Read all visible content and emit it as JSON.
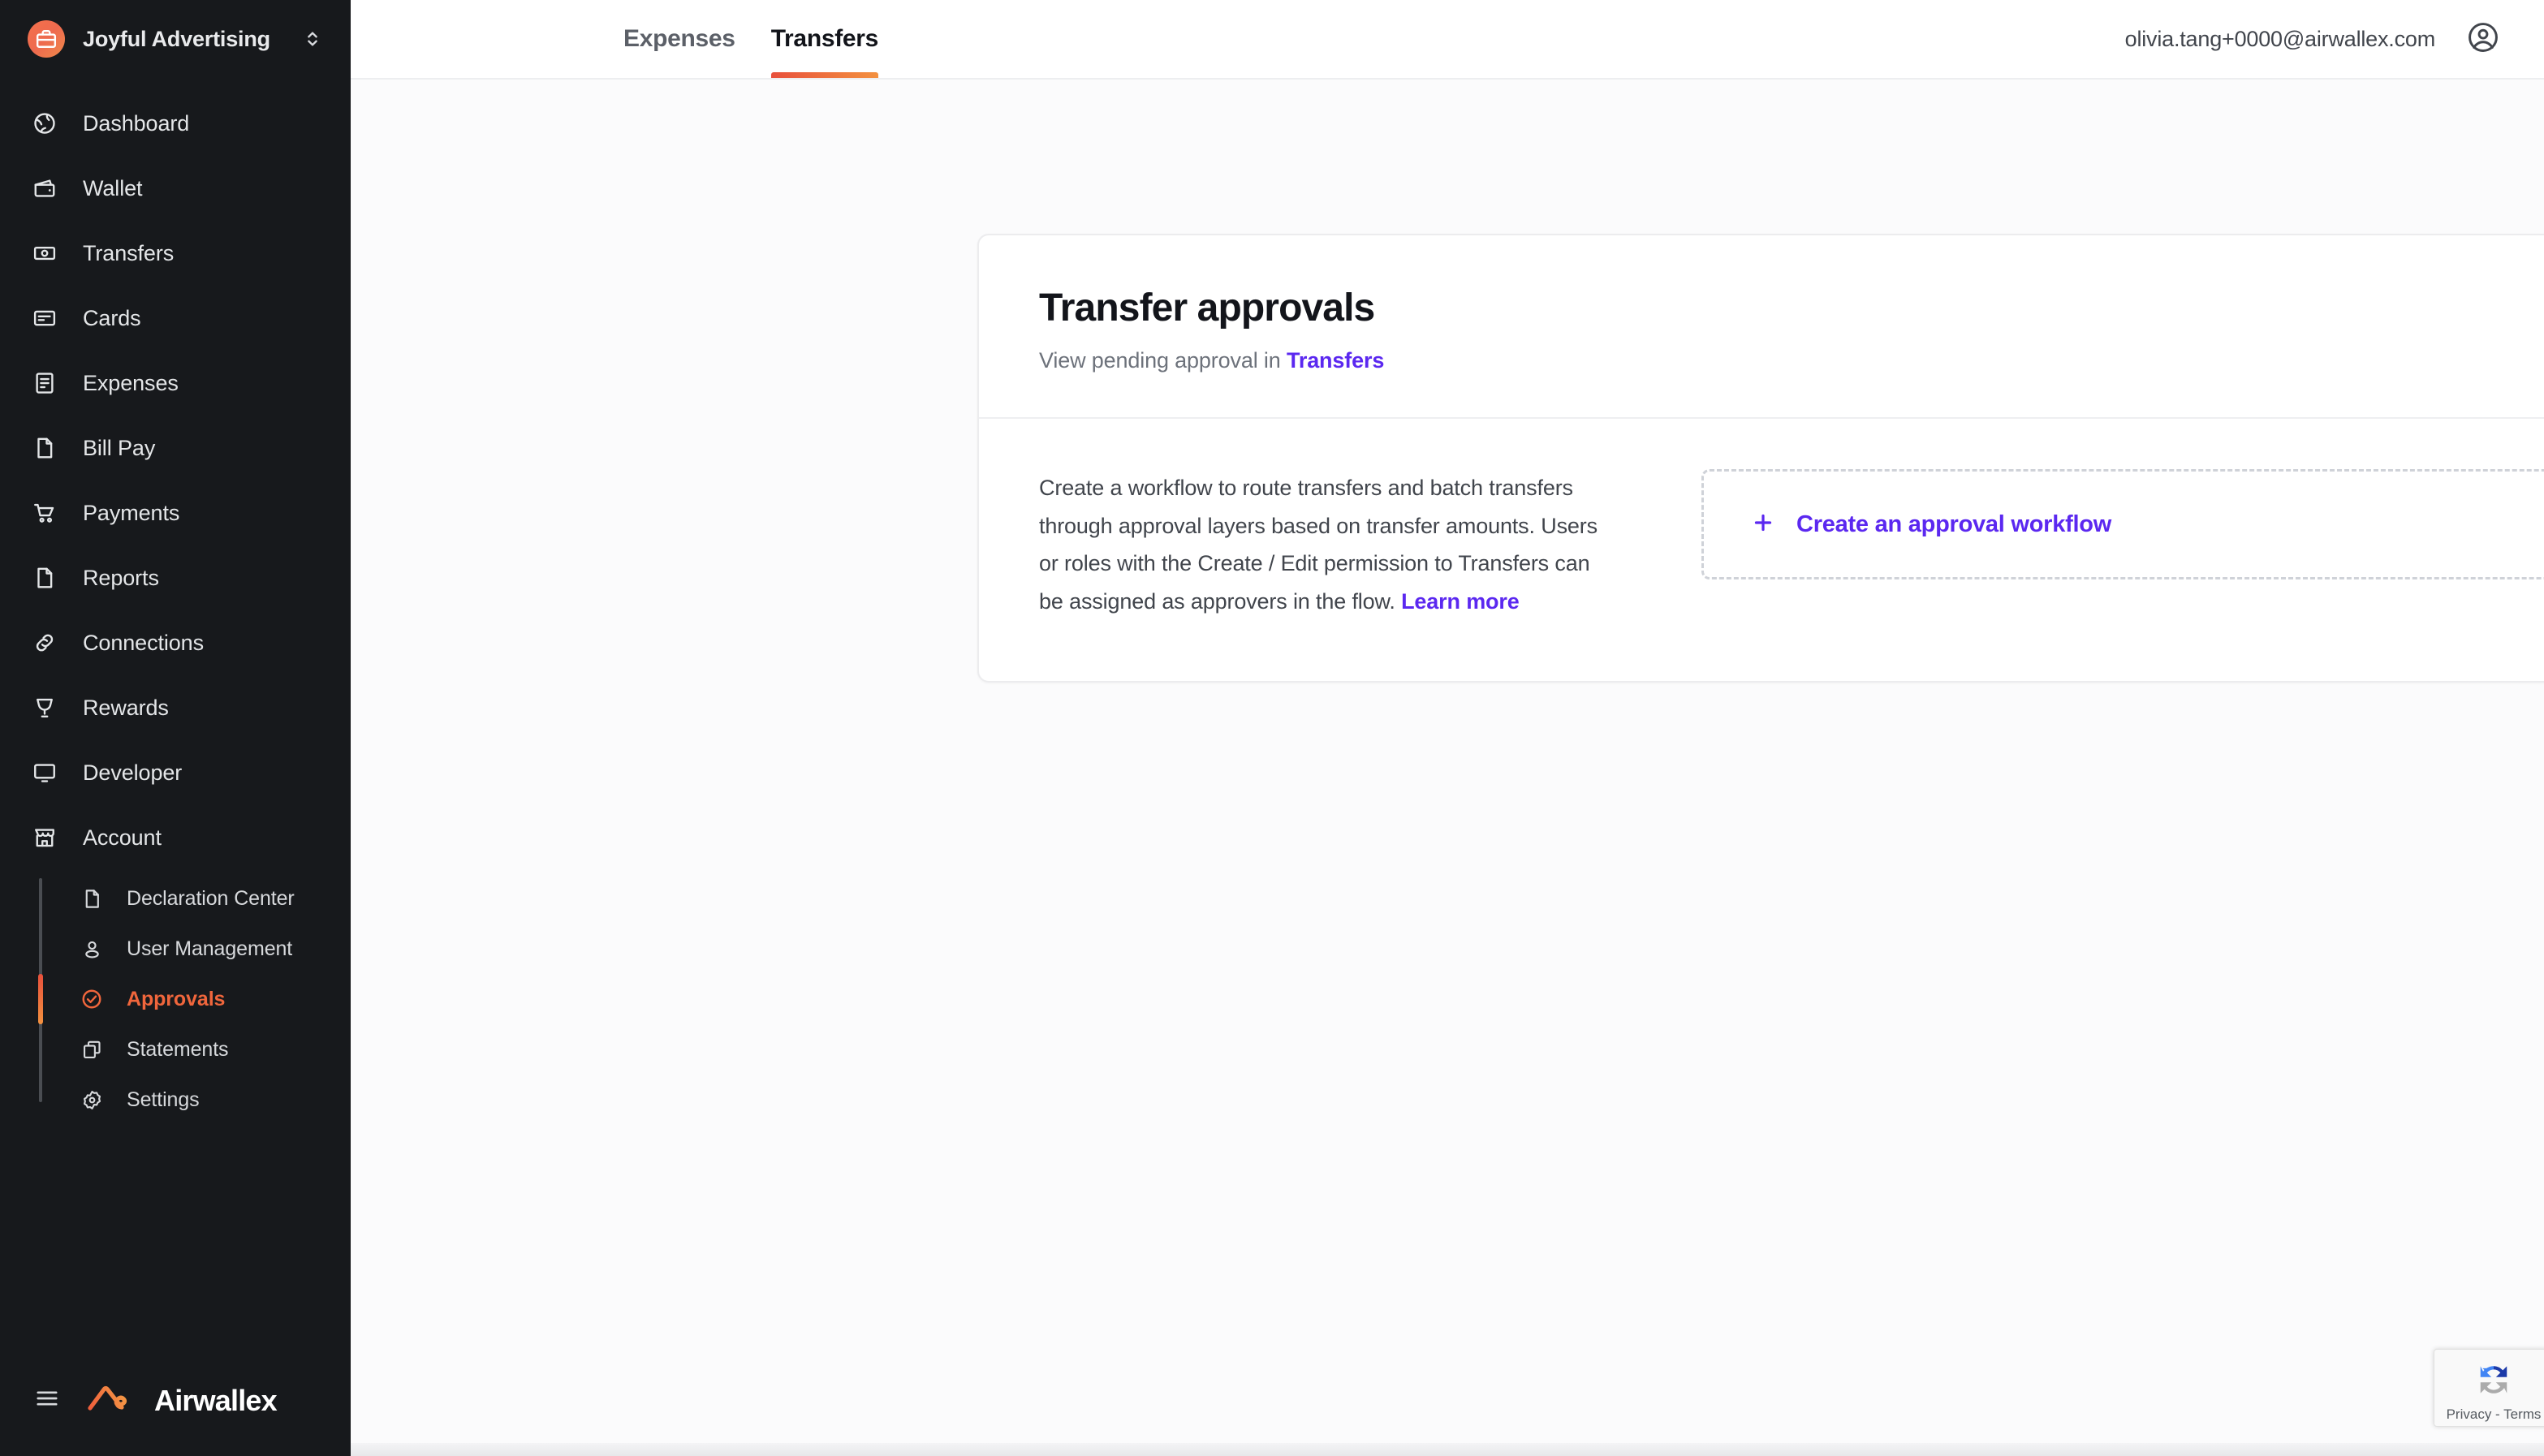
{
  "workspace": {
    "name": "Joyful Advertising",
    "logo_icon": "briefcase-icon",
    "switch_icon": "chevron-up-down-icon",
    "logo_color": "#F0714C"
  },
  "sidebar": {
    "items": [
      {
        "label": "Dashboard",
        "icon": "dashboard-globe-icon"
      },
      {
        "label": "Wallet",
        "icon": "wallet-icon"
      },
      {
        "label": "Transfers",
        "icon": "banknote-icon"
      },
      {
        "label": "Cards",
        "icon": "card-icon"
      },
      {
        "label": "Expenses",
        "icon": "receipt-icon"
      },
      {
        "label": "Bill Pay",
        "icon": "document-icon"
      },
      {
        "label": "Payments",
        "icon": "shopping-cart-icon"
      },
      {
        "label": "Reports",
        "icon": "document-icon"
      },
      {
        "label": "Connections",
        "icon": "link-chain-icon"
      },
      {
        "label": "Rewards",
        "icon": "trophy-icon"
      },
      {
        "label": "Developer",
        "icon": "monitor-icon"
      },
      {
        "label": "Account",
        "icon": "storefront-icon"
      }
    ],
    "subitems": [
      {
        "label": "Declaration Center",
        "icon": "document-icon",
        "active": false
      },
      {
        "label": "User Management",
        "icon": "person-icon",
        "active": false
      },
      {
        "label": "Approvals",
        "icon": "check-circle-icon",
        "active": true
      },
      {
        "label": "Statements",
        "icon": "copy-icon",
        "active": false
      },
      {
        "label": "Settings",
        "icon": "gear-icon",
        "active": false
      }
    ],
    "footer": {
      "menu_icon": "hamburger-menu-icon",
      "brand": "Airwallex",
      "brand_logo_icon": "airwallex-logo-icon"
    },
    "active_color": "#F0663C",
    "background": "#17191C"
  },
  "header": {
    "tabs": [
      {
        "label": "Expenses",
        "active": false
      },
      {
        "label": "Transfers",
        "active": true
      }
    ],
    "user_email": "olivia.tang+0000@airwallex.com",
    "avatar_icon": "user-circle-icon",
    "active_tab_gradient_from": "#E8503C",
    "active_tab_gradient_to": "#F3913F"
  },
  "card": {
    "title": "Transfer approvals",
    "subtitle_prefix": "View pending approval in ",
    "subtitle_link": "Transfers",
    "body_text": "Create a workflow to route transfers and batch transfers through approval layers based on transfer amounts. Users or roles with the Create / Edit permission to Transfers can be assigned as approvers in the flow. ",
    "body_link": "Learn more",
    "cta_label": "Create an approval workflow",
    "cta_icon": "plus-icon",
    "link_color": "#5B28F0"
  },
  "recaptcha": {
    "icon": "recaptcha-icon",
    "text": "Privacy - Terms"
  }
}
